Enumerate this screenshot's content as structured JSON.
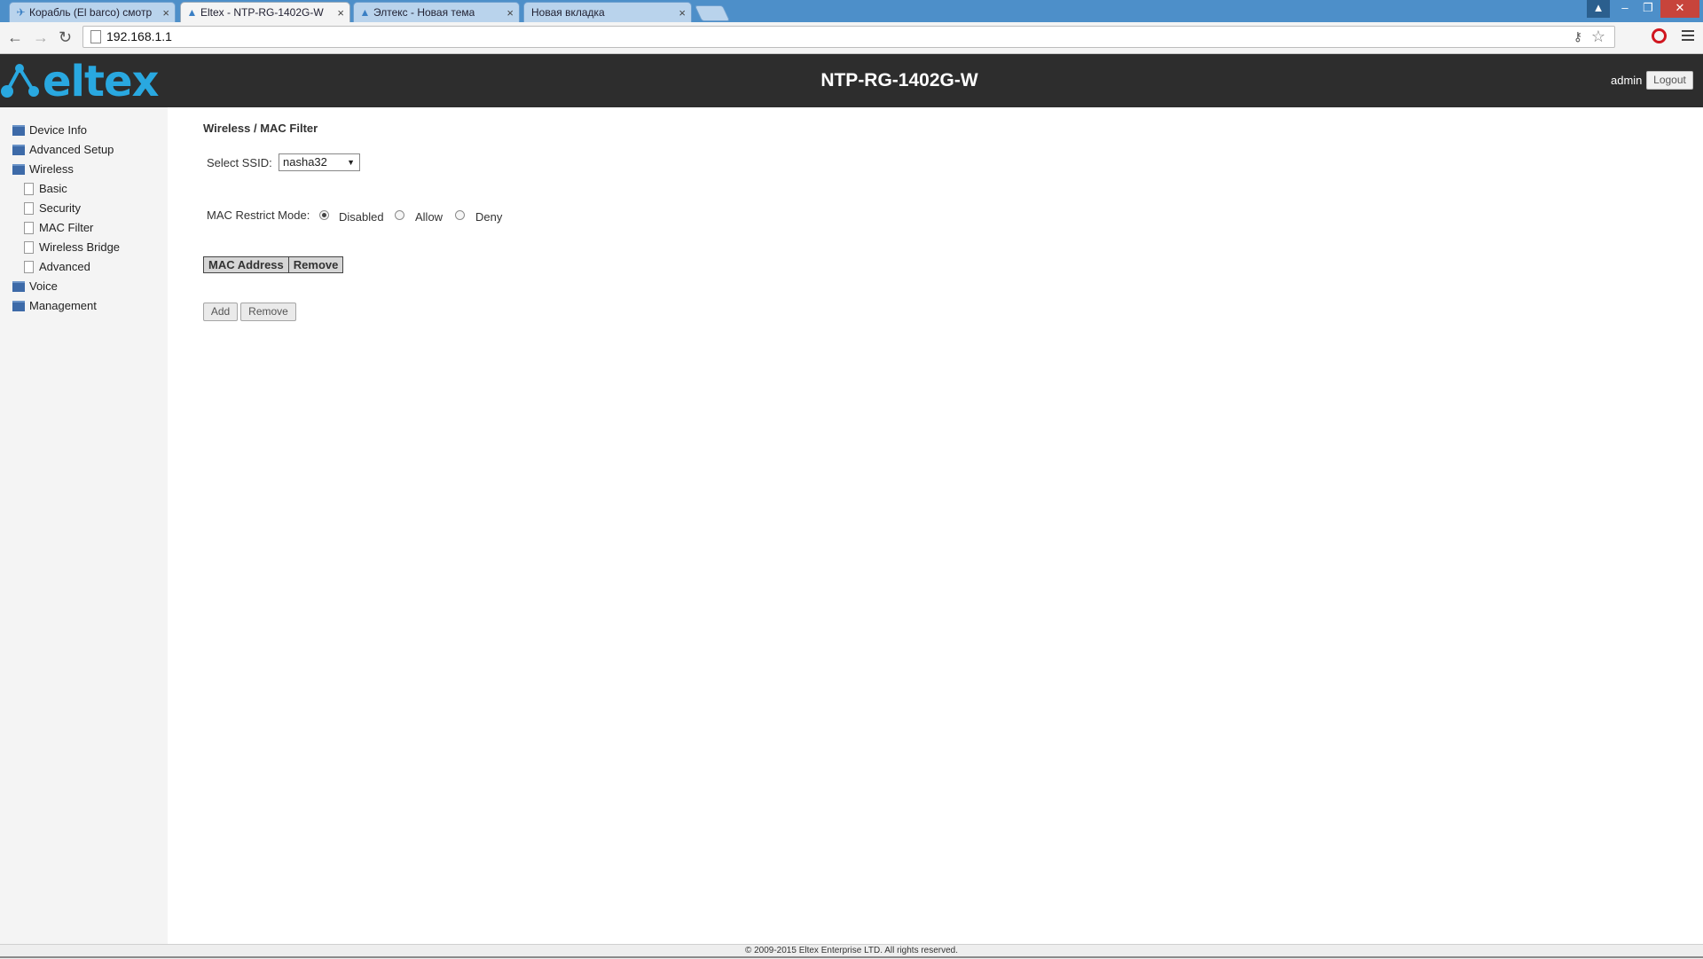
{
  "browser": {
    "tabs": [
      {
        "title": "Корабль (El barco) смотр",
        "active": false
      },
      {
        "title": "Eltex - NTP-RG-1402G-W",
        "active": true
      },
      {
        "title": "Элтекс - Новая тема",
        "active": false
      },
      {
        "title": "Новая вкладка",
        "active": false
      }
    ],
    "url": "192.168.1.1",
    "close_glyph": "×"
  },
  "header": {
    "logo_text": "eltex",
    "device_title": "NTP-RG-1402G-W",
    "user": "admin",
    "logout_label": "Logout"
  },
  "sidebar": {
    "items": [
      {
        "label": "Device Info",
        "level": 0
      },
      {
        "label": "Advanced Setup",
        "level": 0
      },
      {
        "label": "Wireless",
        "level": 0
      },
      {
        "label": "Basic",
        "level": 1
      },
      {
        "label": "Security",
        "level": 1
      },
      {
        "label": "MAC Filter",
        "level": 1
      },
      {
        "label": "Wireless Bridge",
        "level": 1
      },
      {
        "label": "Advanced",
        "level": 1
      },
      {
        "label": "Voice",
        "level": 0
      },
      {
        "label": "Management",
        "level": 0
      }
    ]
  },
  "main": {
    "breadcrumb": "Wireless / MAC Filter",
    "ssid_label": "Select SSID:",
    "ssid_value": "nasha32",
    "mac_mode_label": "MAC Restrict Mode:",
    "mac_modes": [
      {
        "label": "Disabled",
        "checked": true
      },
      {
        "label": "Allow",
        "checked": false
      },
      {
        "label": "Deny",
        "checked": false
      }
    ],
    "table_headers": [
      "MAC Address",
      "Remove"
    ],
    "add_label": "Add",
    "remove_label": "Remove"
  },
  "footer": {
    "copyright": "© 2009-2015 Eltex Enterprise LTD. All rights reserved."
  },
  "colors": {
    "brand_blue": "#29a8e0",
    "header_bg": "#2d2d2d",
    "chrome_frame": "#4d8fc9"
  }
}
